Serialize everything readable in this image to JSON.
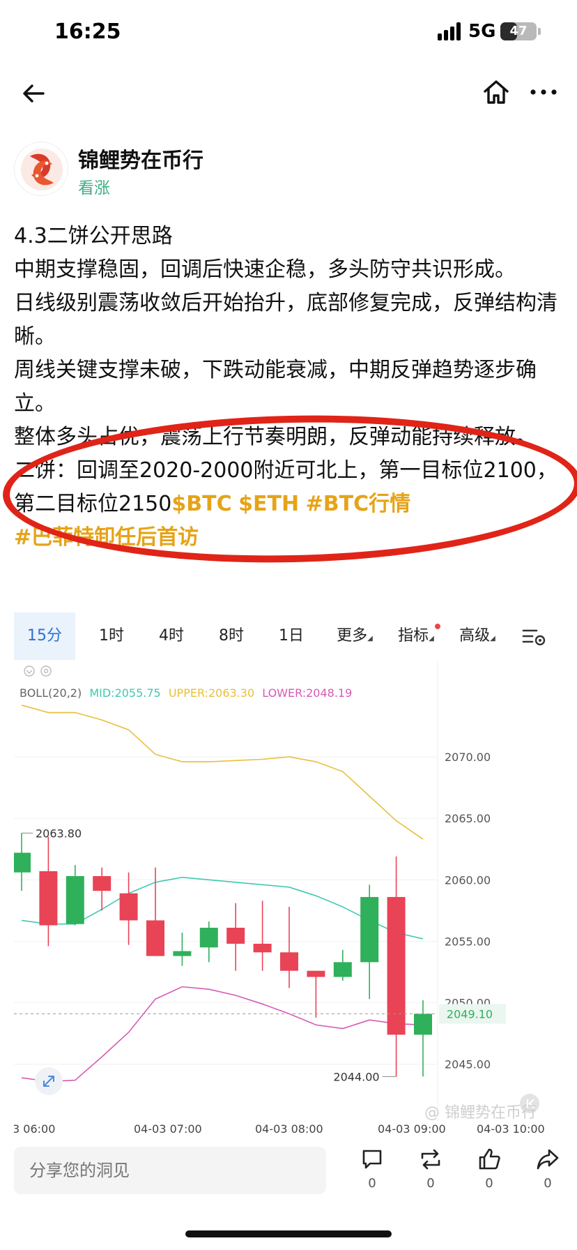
{
  "status_bar": {
    "time": "16:25",
    "network": "5G",
    "battery": "47",
    "battery_level": 0.47
  },
  "nav": {
    "back_icon": "back-arrow-icon",
    "home_icon": "home-icon",
    "more_icon": "more-dots-icon"
  },
  "author": {
    "name": "锦鲤势在币行",
    "tag": "看涨"
  },
  "post": {
    "title": "4.3二饼公开思路",
    "line1": "中期支撑稳固，回调后快速企稳，多头防守共识形成。",
    "line2": "日线级别震荡收敛后开始抬升，底部修复完成，反弹结构清晰。",
    "line3": "周线关键支撑未破，下跌动能衰减，中期反弹趋势逐步确立。",
    "line4": "整体多头占优，震荡上行节奏明朗，反弹动能持续释放。",
    "line5_prefix": "二饼：回调至2020-2000附近可北上，第一目标位2100，第二目标位2150",
    "tag_btc": "$BTC",
    "tag_eth": "$ETH",
    "topic_btc": "#BTC行情",
    "topic_buffett": "#巴菲特卸任后首访"
  },
  "chart_tabs": [
    {
      "label": "15分",
      "active": true
    },
    {
      "label": "1时"
    },
    {
      "label": "4时"
    },
    {
      "label": "8时"
    },
    {
      "label": "1日"
    },
    {
      "label": "更多"
    },
    {
      "label": "指标"
    },
    {
      "label": "高级"
    }
  ],
  "chart_data": {
    "type": "candlestick",
    "indicator": {
      "label": "BOLL(20,2)",
      "mid": "MID:2055.75",
      "upper": "UPPER:2063.30",
      "lower": "LOWER:2048.19",
      "mid_color": "#3fc9b0",
      "upper_color": "#e8bf3a",
      "lower_color": "#d65ab4"
    },
    "y_ticks": [
      "2070.00",
      "2065.00",
      "2060.00",
      "2055.00",
      "2050.00",
      "2045.00"
    ],
    "y_tick_values": [
      2070,
      2065,
      2060,
      2055,
      2050,
      2045
    ],
    "ylim": [
      2042.6,
      2073.8
    ],
    "x_labels": [
      "3 06:00",
      "04-03 07:00",
      "04-03 08:00",
      "04-03 09:00",
      "04-03 10:00"
    ],
    "candles": [
      {
        "o": 2060.6,
        "h": 2063.8,
        "l": 2059.1,
        "c": 2062.2
      },
      {
        "o": 2060.7,
        "h": 2063.5,
        "l": 2054.6,
        "c": 2056.3
      },
      {
        "o": 2056.4,
        "h": 2061.2,
        "l": 2056.3,
        "c": 2060.3
      },
      {
        "o": 2060.3,
        "h": 2061.0,
        "l": 2057.5,
        "c": 2059.1
      },
      {
        "o": 2058.9,
        "h": 2060.6,
        "l": 2054.7,
        "c": 2056.7
      },
      {
        "o": 2056.7,
        "h": 2061.0,
        "l": 2053.8,
        "c": 2053.8
      },
      {
        "o": 2053.8,
        "h": 2055.7,
        "l": 2053.0,
        "c": 2054.2
      },
      {
        "o": 2054.5,
        "h": 2056.6,
        "l": 2053.3,
        "c": 2056.1
      },
      {
        "o": 2056.1,
        "h": 2058.1,
        "l": 2052.6,
        "c": 2054.8
      },
      {
        "o": 2054.8,
        "h": 2058.3,
        "l": 2052.6,
        "c": 2054.1
      },
      {
        "o": 2054.1,
        "h": 2057.8,
        "l": 2051.2,
        "c": 2052.6
      },
      {
        "o": 2052.6,
        "h": 2052.6,
        "l": 2048.8,
        "c": 2052.1
      },
      {
        "o": 2052.1,
        "h": 2054.3,
        "l": 2051.8,
        "c": 2053.3
      },
      {
        "o": 2053.3,
        "h": 2059.6,
        "l": 2050.3,
        "c": 2058.6
      },
      {
        "o": 2058.6,
        "h": 2061.9,
        "l": 2044.0,
        "c": 2047.4
      },
      {
        "o": 2047.4,
        "h": 2050.2,
        "l": 2044.0,
        "c": 2049.1
      }
    ],
    "upper_band": [
      2074.2,
      2073.6,
      2073.6,
      2073.0,
      2072.2,
      2070.2,
      2069.6,
      2069.6,
      2069.7,
      2069.8,
      2070.0,
      2069.6,
      2068.8,
      2066.8,
      2064.8,
      2063.3
    ],
    "mid_band": [
      2056.7,
      2056.4,
      2056.4,
      2057.6,
      2058.9,
      2059.8,
      2060.2,
      2060.0,
      2059.8,
      2059.6,
      2059.4,
      2058.7,
      2057.8,
      2056.7,
      2055.7,
      2055.2
    ],
    "lower_band": [
      2043.9,
      2043.6,
      2043.7,
      2045.6,
      2047.6,
      2050.3,
      2051.3,
      2051.1,
      2050.6,
      2049.9,
      2049.1,
      2048.2,
      2047.9,
      2048.6,
      2048.3,
      2048.2
    ],
    "last_price": "2049.10",
    "last_price_value": 2049.1,
    "high_label": "2063.80",
    "low_label": "2044.00",
    "watermark": "@ 锦鲤势在币行",
    "up_color": "#2fb05b",
    "down_color": "#e94356"
  },
  "actions": {
    "comment_placeholder": "分享您的洞见",
    "comment_count": "0",
    "repost_count": "0",
    "like_count": "0",
    "share_count": "0"
  }
}
